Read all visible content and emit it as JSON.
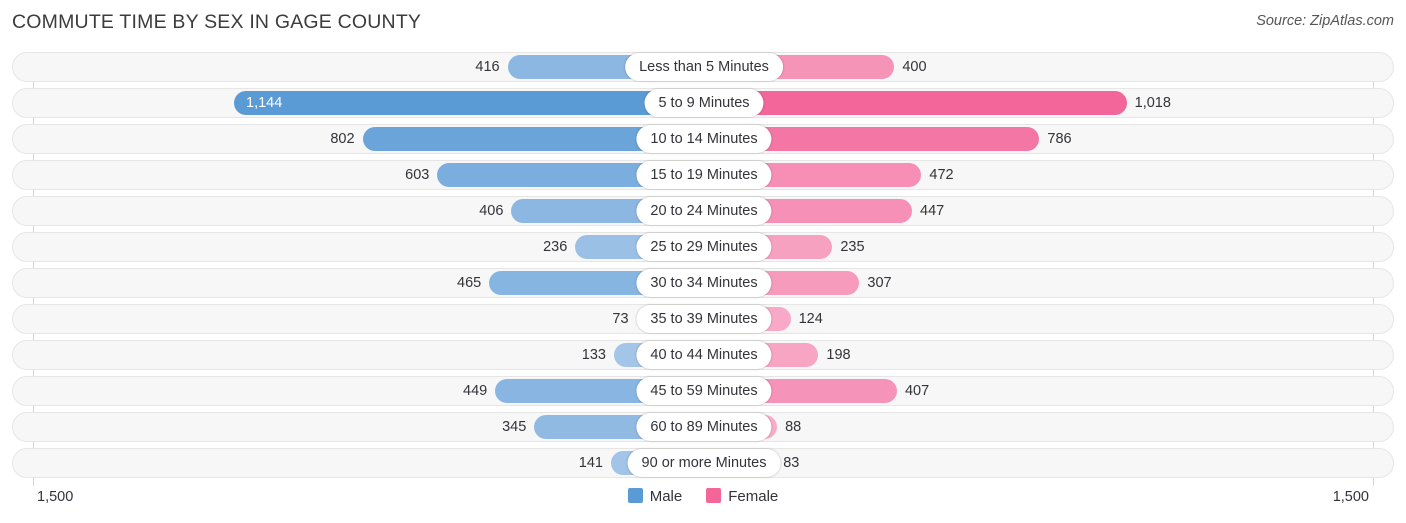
{
  "header": {
    "title": "COMMUTE TIME BY SEX IN GAGE COUNTY",
    "source": "Source: ZipAtlas.com"
  },
  "axis": {
    "left_tick": "1,500",
    "right_tick": "1,500"
  },
  "legend": {
    "items": [
      {
        "label": "Male",
        "color": "#5b9bd5"
      },
      {
        "label": "Female",
        "color": "#f2669a"
      }
    ]
  },
  "chart_data": {
    "type": "bar",
    "title": "COMMUTE TIME BY SEX IN GAGE COUNTY",
    "subtitle": "Source: ZipAtlas.com",
    "orientation": "horizontal-diverging",
    "xlabel": "",
    "ylabel": "",
    "xlim": [
      1500,
      1500
    ],
    "axis_tick_labels": [
      "1,500",
      "1,500"
    ],
    "grid": false,
    "legend_position": "bottom-center",
    "categories": [
      "Less than 5 Minutes",
      "5 to 9 Minutes",
      "10 to 14 Minutes",
      "15 to 19 Minutes",
      "20 to 24 Minutes",
      "25 to 29 Minutes",
      "30 to 34 Minutes",
      "35 to 39 Minutes",
      "40 to 44 Minutes",
      "45 to 59 Minutes",
      "60 to 89 Minutes",
      "90 or more Minutes"
    ],
    "series": [
      {
        "name": "Male",
        "color": "#5b9bd5",
        "values": [
          416,
          1144,
          802,
          603,
          406,
          236,
          465,
          73,
          133,
          449,
          345,
          141
        ],
        "labels": [
          "416",
          "1,144",
          "802",
          "603",
          "406",
          "236",
          "465",
          "73",
          "133",
          "449",
          "345",
          "141"
        ]
      },
      {
        "name": "Female",
        "color": "#f2669a",
        "values": [
          400,
          1018,
          786,
          472,
          447,
          235,
          307,
          124,
          198,
          407,
          88,
          83
        ],
        "labels": [
          "400",
          "1,018",
          "786",
          "472",
          "447",
          "235",
          "307",
          "124",
          "198",
          "407",
          "88",
          "83"
        ]
      }
    ]
  },
  "rows": [
    {
      "category": "Less than 5 Minutes",
      "male": "416",
      "female": "400",
      "male_value": 416,
      "female_value": 400
    },
    {
      "category": "5 to 9 Minutes",
      "male": "1,144",
      "female": "1,018",
      "male_value": 1144,
      "female_value": 1018
    },
    {
      "category": "10 to 14 Minutes",
      "male": "802",
      "female": "786",
      "male_value": 802,
      "female_value": 786
    },
    {
      "category": "15 to 19 Minutes",
      "male": "603",
      "female": "472",
      "male_value": 603,
      "female_value": 472
    },
    {
      "category": "20 to 24 Minutes",
      "male": "406",
      "female": "447",
      "male_value": 406,
      "female_value": 447
    },
    {
      "category": "25 to 29 Minutes",
      "male": "236",
      "female": "235",
      "male_value": 236,
      "female_value": 235
    },
    {
      "category": "30 to 34 Minutes",
      "male": "465",
      "female": "307",
      "male_value": 465,
      "female_value": 307
    },
    {
      "category": "35 to 39 Minutes",
      "male": "73",
      "female": "124",
      "male_value": 73,
      "female_value": 124
    },
    {
      "category": "40 to 44 Minutes",
      "male": "133",
      "female": "198",
      "male_value": 133,
      "female_value": 198
    },
    {
      "category": "45 to 59 Minutes",
      "male": "449",
      "female": "407",
      "male_value": 449,
      "female_value": 407
    },
    {
      "category": "60 to 89 Minutes",
      "male": "345",
      "female": "88",
      "male_value": 345,
      "female_value": 88
    },
    {
      "category": "90 or more Minutes",
      "male": "141",
      "female": "83",
      "male_value": 141,
      "female_value": 83
    }
  ]
}
